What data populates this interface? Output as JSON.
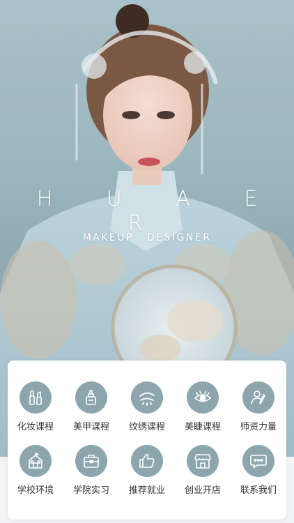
{
  "hero": {
    "brand": "H U A E R",
    "tagline": "MAKEUP DESIGNER"
  },
  "colors": {
    "icon_bg": "#8da6ad",
    "hero_bg": "#9db7bf",
    "card_bg": "#ffffff",
    "label_text": "#333333"
  },
  "menu": {
    "items": [
      {
        "label": "化妆课程",
        "icon": "cosmetics-icon"
      },
      {
        "label": "美甲课程",
        "icon": "nail-polish-icon"
      },
      {
        "label": "纹绣课程",
        "icon": "eyebrow-icon"
      },
      {
        "label": "美睫课程",
        "icon": "eyelash-icon"
      },
      {
        "label": "师资力量",
        "icon": "teacher-icon"
      },
      {
        "label": "学校环境",
        "icon": "school-building-icon"
      },
      {
        "label": "学院实习",
        "icon": "briefcase-icon"
      },
      {
        "label": "推荐就业",
        "icon": "thumbs-up-icon"
      },
      {
        "label": "创业开店",
        "icon": "storefront-icon"
      },
      {
        "label": "联系我们",
        "icon": "chat-bubble-icon"
      }
    ]
  }
}
